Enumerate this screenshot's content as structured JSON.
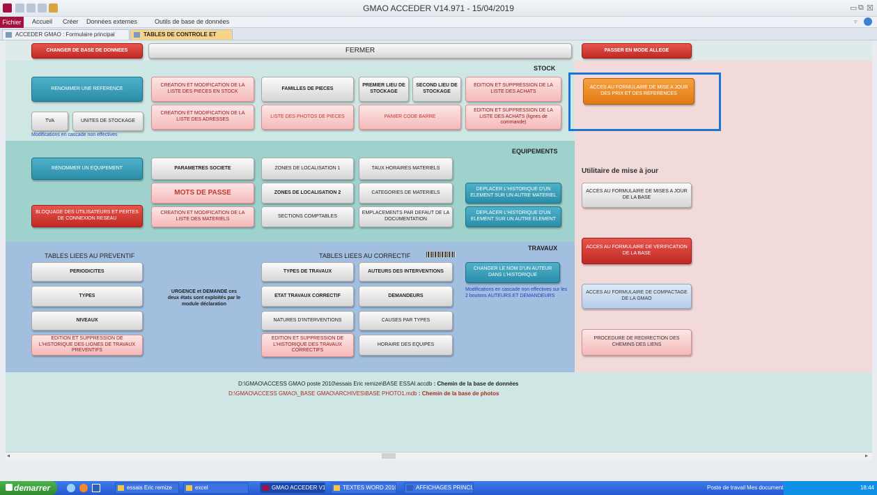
{
  "window": {
    "title": "GMAO ACCEDER V14.971 - 15/04/2019",
    "controls": [
      "▭",
      "⧉",
      "☒"
    ]
  },
  "ribbon": {
    "tabs": [
      "Fichier",
      "Accueil",
      "Créer",
      "Données externes",
      "Outils de base de données"
    ]
  },
  "doc_tabs": [
    "ACCEDER GMAO : Formulaire principal",
    "TABLES DE CONTROLE ET PARAMETRAGE"
  ],
  "top": {
    "change_db": "CHANGER DE BASE DE DONNEES",
    "close": "FERMER",
    "light_mode": "PASSER EN MODE ALLEGE"
  },
  "stock": {
    "header": "STOCK",
    "rename_ref": "RENOMMER UNE REFERENCE",
    "parts_list": "CREATION ET MODIFICATION DE LA LISTE DES PIECES EN STOCK",
    "families": "FAMILLES DE PIECES",
    "first_loc": "PREMIER LIEU DE STOCKAGE",
    "second_loc": "SECOND LIEU DE STOCKAGE",
    "edit_purchases": "EDITION ET SUPPRESSION DE LA LISTE DES ACHATS",
    "tva": "TVA",
    "units": "UNITES DE STOCKAGE",
    "addresses": "CREATION ET MODIFICATION DE LA LISTE DES ADRESSES",
    "photos": "LISTE DES PHOTOS DE PIECES",
    "barcode": "PANIER CODE BARRE",
    "edit_purchase_lines": "EDITION ET SUPPRESSION DE LA LISTE DES ACHATS (lignes de commande)",
    "cascade_note": "Modifications en cascade non effectives"
  },
  "equip": {
    "header": "EQUIPEMENTS",
    "rename": "RENOMMER UN EQUIPEMENT",
    "company": "PARAMETRES SOCIETE",
    "zones1": "ZONES DE LOCALISATION 1",
    "rates": "TAUX HORAIRES MATERIELS",
    "passwords": "MOTS DE PASSE",
    "zones2": "ZONES DE LOCALISATION 2",
    "categories": "CATEGORIES DE MATERIELS",
    "move_hist_mat": "DEPLACER L'HISTORIQUE D'UN ELEMENT SUR UN AUTRE MATERIEL",
    "block_users": "BLOQUAGE DES UTILISATEURS ET PERTES DE CONNEXION RESEAU",
    "materials_list": "CREATION ET MODIFICATION DE LA LISTE DES MATERIELS",
    "accounting": "SECTIONS COMPTABLES",
    "doc_locations": "EMPLACEMENTS PAR DEFAUT DE LA DOCUMENTATION",
    "move_hist_elem": "DEPLACER L'HISTORIQUE D'UN ELEMENT SUR UN AUTRE ELEMENT"
  },
  "travaux": {
    "header": "TRAVAUX",
    "preventif": "TABLES LIEES AU PREVENTIF",
    "correctif": "TABLES LIEES AU CORRECTIF",
    "periodicites": "PERIODICITES",
    "types": "TYPES",
    "niveaux": "NIVEAUX",
    "edit_prev": "EDITION ET SUPPRESSION DE L'HISTORIQUE DES LIGNES DE TRAVAUX PREVENTIFS",
    "urgence_note": "URGENCE et DEMANDE ces deux états sont exploités par le module déclaration",
    "work_types": "TYPES DE TRAVAUX",
    "authors": "AUTEURS DES INTERVENTIONS",
    "status": "ETAT TRAVAUX CORRECTIF",
    "requesters": "DEMANDEURS",
    "natures": "NATURES D'INTERVENTIONS",
    "causes": "CAUSES PAR TYPES",
    "edit_corr": "EDITION ET SUPPRESSION DE L'HISTORIQUE DES TRAVAUX CORRECTIFS",
    "hours": "HORAIRE DES EQUIPES",
    "rename_author": "CHANGER LE NOM D'UN AUTEUR DANS L'HISTORIQUE",
    "cascade_note": "Modifications en cascade non effectives sur les 2 boutons AUTEURS ET DEMANDEURS"
  },
  "right": {
    "price_update": "ACCES AU FORMULAIRE DE MISE A JOUR DES PRIX ET DES REFERENCES",
    "utility_title": "Utilitaire de mise à jour",
    "db_update": "ACCES AU FORMULAIRE DE MISES A JOUR DE LA BASE",
    "verify": "ACCES AU FORMULAIRE DE VERIFICATION DE LA BASE",
    "compact": "ACCES AU FORMULAIRE DE COMPACTAGE DE LA GMAO",
    "redirect": "PROCEDURE DE REDIRECTION DES CHEMINS DES LIENS"
  },
  "paths": {
    "db_path": "D:\\GMAO\\ACCESS GMAO poste 2010\\essais Eric remize\\BASE ESSAI.accdb",
    "db_label": ": Chemin de la base de données",
    "photo_path": "D:\\GMAO\\ACCESS GMAO\\_BASE GMAO\\ARCHIVES\\BASE PHOTO1.mdb",
    "photo_label": ": Chemin de la base de photos"
  },
  "taskbar": {
    "start": "demarrer",
    "items": [
      "essais Eric remize",
      "excel",
      "GMAO ACCEDER V14...",
      "TEXTES WORD 2010",
      "AFFICHAGES PRINCI..."
    ],
    "places": [
      "Poste de travail",
      "Mes documents"
    ],
    "clock": "18:44"
  },
  "colors": {
    "accent_red": "#c02a24",
    "teal": "#2b8ea8",
    "orange": "#e07a12",
    "highlight": "#1874d6"
  }
}
